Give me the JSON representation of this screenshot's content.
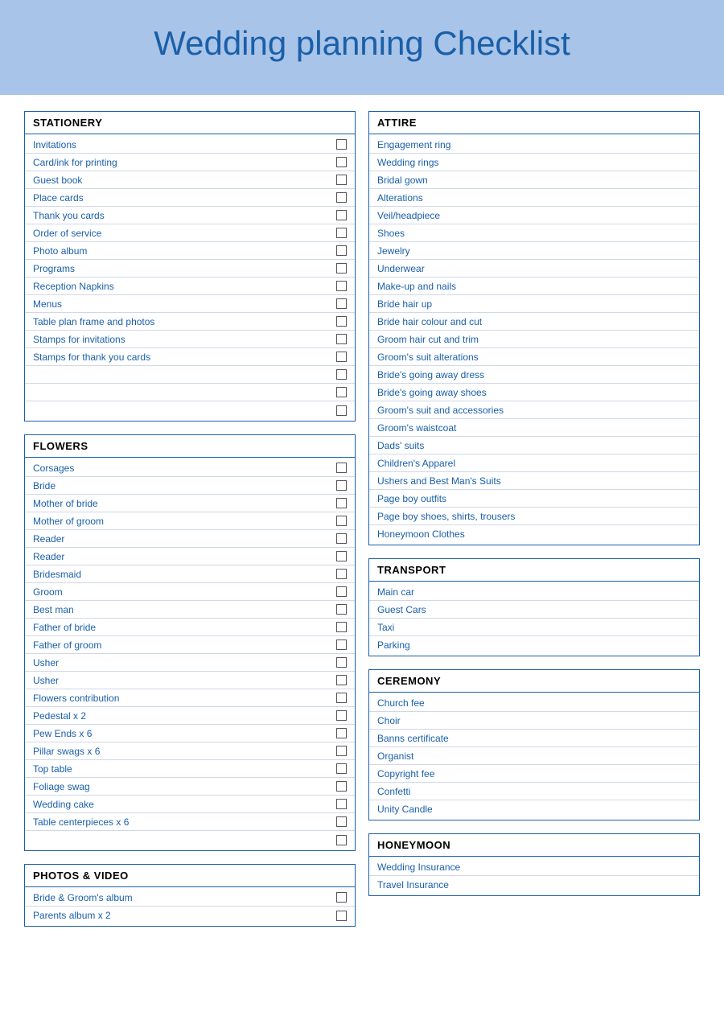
{
  "header": {
    "title": "Wedding planning Checklist"
  },
  "sections": [
    {
      "id": "stationery",
      "label": "STATIONERY",
      "column": 0,
      "items": [
        {
          "text": "Invitations",
          "hasCheckbox": true
        },
        {
          "text": "Card/ink for printing",
          "hasCheckbox": true
        },
        {
          "text": "Guest book",
          "hasCheckbox": true
        },
        {
          "text": "Place cards",
          "hasCheckbox": true
        },
        {
          "text": "Thank you cards",
          "hasCheckbox": true
        },
        {
          "text": "Order of service",
          "hasCheckbox": true
        },
        {
          "text": "Photo album",
          "hasCheckbox": true
        },
        {
          "text": "Programs",
          "hasCheckbox": true
        },
        {
          "text": "Reception Napkins",
          "hasCheckbox": true
        },
        {
          "text": "Menus",
          "hasCheckbox": true
        },
        {
          "text": "Table plan frame and photos",
          "hasCheckbox": true
        },
        {
          "text": "Stamps for invitations",
          "hasCheckbox": true
        },
        {
          "text": "Stamps for thank you cards",
          "hasCheckbox": true
        },
        {
          "text": "",
          "hasCheckbox": true
        },
        {
          "text": "",
          "hasCheckbox": true
        },
        {
          "text": "",
          "hasCheckbox": true
        }
      ]
    },
    {
      "id": "attire",
      "label": "ATTIRE",
      "column": 1,
      "items": [
        {
          "text": "Engagement ring",
          "hasCheckbox": false
        },
        {
          "text": "Wedding rings",
          "hasCheckbox": false
        },
        {
          "text": "Bridal gown",
          "hasCheckbox": false
        },
        {
          "text": "Alterations",
          "hasCheckbox": false
        },
        {
          "text": "Veil/headpiece",
          "hasCheckbox": false
        },
        {
          "text": "Shoes",
          "hasCheckbox": false
        },
        {
          "text": "Jewelry",
          "hasCheckbox": false
        },
        {
          "text": "Underwear",
          "hasCheckbox": false
        },
        {
          "text": "Make-up and nails",
          "hasCheckbox": false
        },
        {
          "text": "Bride hair up",
          "hasCheckbox": false
        },
        {
          "text": "Bride hair colour and cut",
          "hasCheckbox": false
        },
        {
          "text": "Groom hair cut and trim",
          "hasCheckbox": false
        },
        {
          "text": "Groom's suit alterations",
          "hasCheckbox": false
        },
        {
          "text": "Bride's going away dress",
          "hasCheckbox": false
        },
        {
          "text": "Bride's going away shoes",
          "hasCheckbox": false
        },
        {
          "text": "Groom's suit and accessories",
          "hasCheckbox": false
        },
        {
          "text": "Groom's waistcoat",
          "hasCheckbox": false
        },
        {
          "text": "Dads' suits",
          "hasCheckbox": false
        },
        {
          "text": "Children's Apparel",
          "hasCheckbox": false
        },
        {
          "text": "Ushers and Best Man's Suits",
          "hasCheckbox": false
        },
        {
          "text": "Page boy outfits",
          "hasCheckbox": false
        },
        {
          "text": "Page boy shoes, shirts, trousers",
          "hasCheckbox": false
        },
        {
          "text": "Honeymoon Clothes",
          "hasCheckbox": false
        }
      ]
    },
    {
      "id": "flowers",
      "label": "FLOWERS",
      "column": 0,
      "items": [
        {
          "text": "Corsages",
          "hasCheckbox": true
        },
        {
          "text": "Bride",
          "hasCheckbox": true
        },
        {
          "text": "Mother of bride",
          "hasCheckbox": true
        },
        {
          "text": "Mother of groom",
          "hasCheckbox": true
        },
        {
          "text": "Reader",
          "hasCheckbox": true
        },
        {
          "text": "Reader",
          "hasCheckbox": true
        },
        {
          "text": "Bridesmaid",
          "hasCheckbox": true
        },
        {
          "text": "Groom",
          "hasCheckbox": true
        },
        {
          "text": "Best man",
          "hasCheckbox": true
        },
        {
          "text": "Father of bride",
          "hasCheckbox": true
        },
        {
          "text": "Father of groom",
          "hasCheckbox": true
        },
        {
          "text": "Usher",
          "hasCheckbox": true
        },
        {
          "text": "Usher",
          "hasCheckbox": true
        },
        {
          "text": "Flowers contribution",
          "hasCheckbox": true
        },
        {
          "text": "Pedestal x 2",
          "hasCheckbox": true
        },
        {
          "text": "Pew Ends x 6",
          "hasCheckbox": true
        },
        {
          "text": "Pillar swags x 6",
          "hasCheckbox": true
        },
        {
          "text": "Top table",
          "hasCheckbox": true
        },
        {
          "text": "Foliage swag",
          "hasCheckbox": true
        },
        {
          "text": "Wedding cake",
          "hasCheckbox": true
        },
        {
          "text": "Table centerpieces x 6",
          "hasCheckbox": true
        },
        {
          "text": "",
          "hasCheckbox": true
        }
      ]
    },
    {
      "id": "transport",
      "label": "TRANSPORT",
      "column": 1,
      "items": [
        {
          "text": "Main car",
          "hasCheckbox": false
        },
        {
          "text": "Guest Cars",
          "hasCheckbox": false
        },
        {
          "text": "Taxi",
          "hasCheckbox": false
        },
        {
          "text": "Parking",
          "hasCheckbox": false
        }
      ]
    },
    {
      "id": "ceremony",
      "label": "CEREMONY",
      "column": 1,
      "items": [
        {
          "text": "Church fee",
          "hasCheckbox": false
        },
        {
          "text": "Choir",
          "hasCheckbox": false
        },
        {
          "text": "Banns certificate",
          "hasCheckbox": false
        },
        {
          "text": "Organist",
          "hasCheckbox": false
        },
        {
          "text": "Copyright fee",
          "hasCheckbox": false
        },
        {
          "text": "Confetti",
          "hasCheckbox": false
        },
        {
          "text": "Unity Candle",
          "hasCheckbox": false
        }
      ]
    },
    {
      "id": "photos",
      "label": "PHOTOS & VIDEO",
      "column": 0,
      "items": [
        {
          "text": "Bride & Groom's album",
          "hasCheckbox": true
        },
        {
          "text": "Parents album x 2",
          "hasCheckbox": true
        }
      ]
    },
    {
      "id": "honeymoon",
      "label": "HONEYMOON",
      "column": 1,
      "items": [
        {
          "text": "Wedding Insurance",
          "hasCheckbox": false
        },
        {
          "text": "Travel Insurance",
          "hasCheckbox": false
        }
      ]
    }
  ]
}
